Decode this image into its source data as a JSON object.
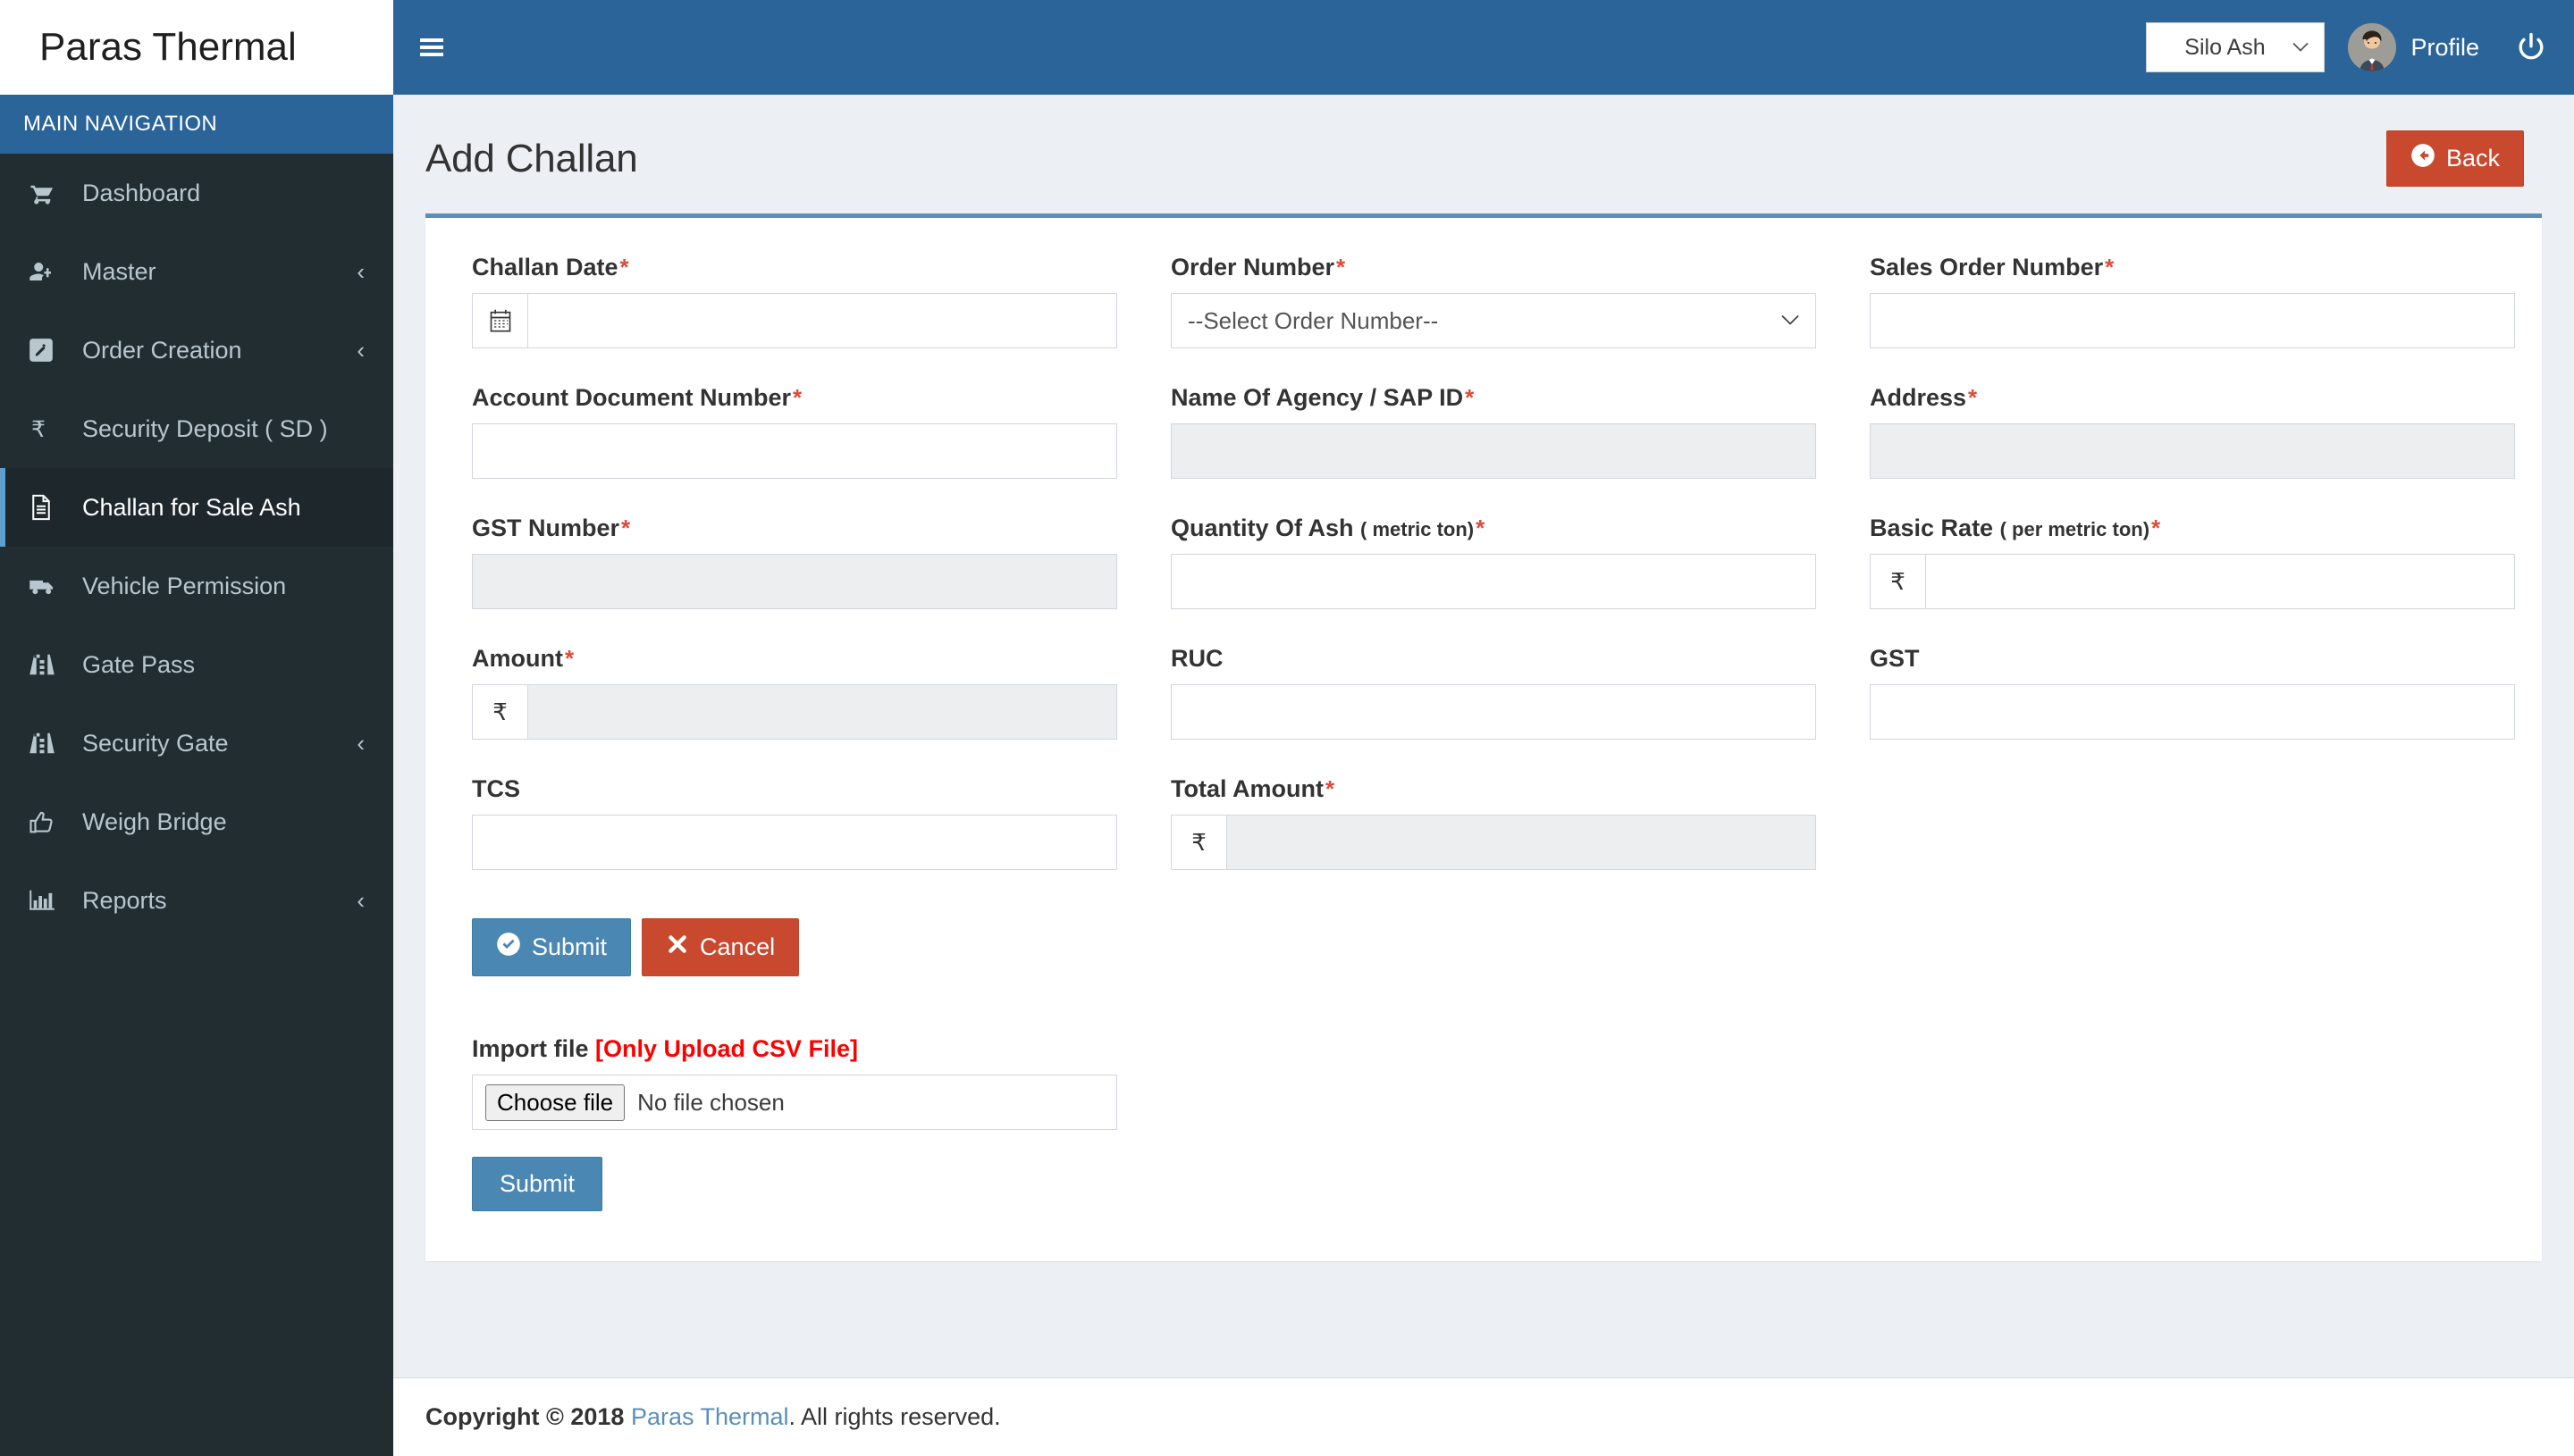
{
  "brand": {
    "title": "Paras Thermal"
  },
  "sidebar": {
    "heading": "MAIN NAVIGATION",
    "items": [
      {
        "label": "Dashboard",
        "icon": "cart-icon",
        "caret": "",
        "active": false
      },
      {
        "label": "Master",
        "icon": "user-plus-icon",
        "caret": "‹",
        "active": false
      },
      {
        "label": "Order Creation",
        "icon": "pencil-square-icon",
        "caret": "‹",
        "active": false
      },
      {
        "label": "Security Deposit ( SD )",
        "icon": "rupee-icon",
        "caret": "",
        "active": false
      },
      {
        "label": "Challan for Sale Ash",
        "icon": "document-icon",
        "caret": "",
        "active": true
      },
      {
        "label": "Vehicle Permission",
        "icon": "truck-icon",
        "caret": "",
        "active": false
      },
      {
        "label": "Gate Pass",
        "icon": "road-icon",
        "caret": "",
        "active": false
      },
      {
        "label": "Security Gate",
        "icon": "road-icon",
        "caret": "‹",
        "active": false
      },
      {
        "label": "Weigh Bridge",
        "icon": "thumbs-up-icon",
        "caret": "",
        "active": false
      },
      {
        "label": "Reports",
        "icon": "bar-chart-icon",
        "caret": "‹",
        "active": false
      }
    ]
  },
  "topbar": {
    "menu_toggle": "hamburger-icon",
    "site_selector": {
      "value": "Silo Ash",
      "caret": "⌄"
    },
    "profile_label": "Profile",
    "logout_icon": "power-icon"
  },
  "content": {
    "page_title": "Add Challan",
    "back_button": "Back"
  },
  "form": {
    "fields": {
      "challan_date": {
        "label": "Challan Date",
        "required": "*",
        "value": "",
        "addon": "calendar-icon"
      },
      "order_number": {
        "label": "Order Number",
        "required": "*",
        "selected": "--Select Order Number--"
      },
      "sales_order": {
        "label": "Sales Order Number",
        "required": "*",
        "value": ""
      },
      "account_doc": {
        "label": "Account Document Number",
        "required": "*",
        "value": ""
      },
      "agency_name": {
        "label": "Name Of Agency / SAP ID",
        "required": "*",
        "value": ""
      },
      "address": {
        "label": "Address",
        "required": "*",
        "value": ""
      },
      "gst_number": {
        "label": "GST Number",
        "required": "*",
        "value": ""
      },
      "qty_ash": {
        "label": "Quantity Of Ash ",
        "label_sub": "( metric ton)",
        "required": "*",
        "value": ""
      },
      "basic_rate": {
        "label": "Basic Rate ",
        "label_sub": "( per metric ton)",
        "required": "*",
        "value": "",
        "addon": "₹"
      },
      "amount": {
        "label": "Amount",
        "required": "*",
        "value": "",
        "addon": "₹"
      },
      "ruc": {
        "label": "RUC",
        "required": "",
        "value": ""
      },
      "gst": {
        "label": "GST",
        "required": "",
        "value": ""
      },
      "tcs": {
        "label": "TCS",
        "required": "",
        "value": ""
      },
      "total_amount": {
        "label": "Total Amount",
        "required": "*",
        "value": "",
        "addon": "₹"
      }
    },
    "submit_label": "Submit",
    "cancel_label": "Cancel"
  },
  "import": {
    "label": "Import file ",
    "note": "[Only Upload CSV File]",
    "choose_file_label": "Choose file",
    "no_file_text": "No file chosen",
    "submit_label": "Submit"
  },
  "footer": {
    "copyright_prefix": "Copyright © 2018 ",
    "company": "Paras Thermal",
    "suffix": ". All rights reserved."
  },
  "colors": {
    "header_blue": "#2b6499",
    "sidebar_dark": "#222d32",
    "accent_blue": "#5a8fba",
    "danger_red": "#c9492f",
    "required_red": "#dd4b39"
  }
}
